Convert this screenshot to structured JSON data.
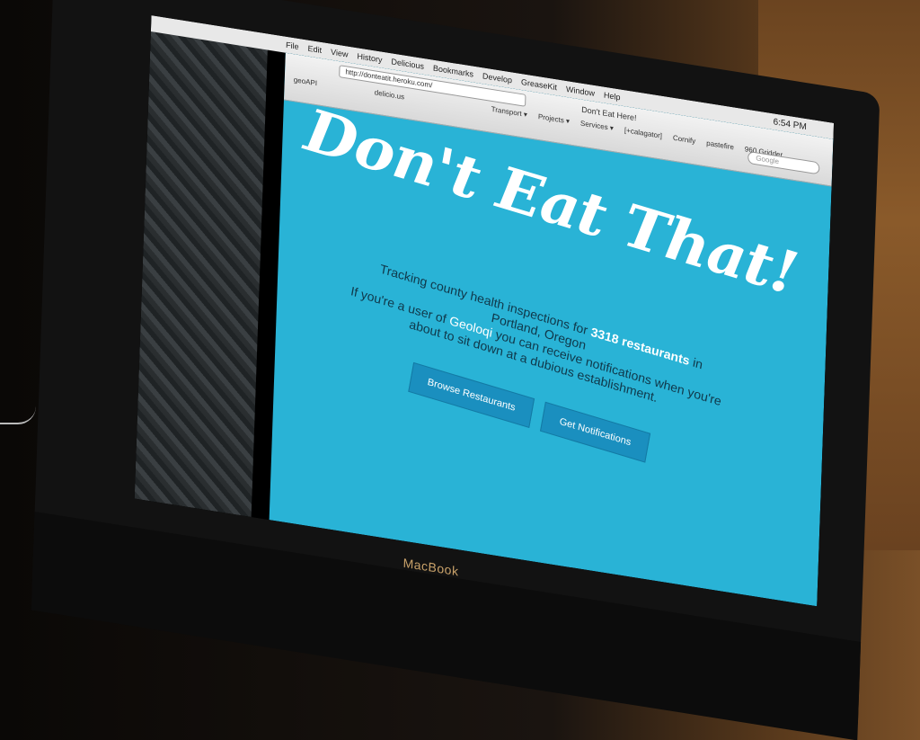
{
  "menubar": {
    "items": [
      "File",
      "Edit",
      "View",
      "History",
      "Delicious",
      "Bookmarks",
      "Develop",
      "GreaseKit",
      "Window",
      "Help"
    ],
    "clock": "6:54 PM"
  },
  "browser": {
    "url": "http://donteatit.heroku.com/",
    "tab_title": "Don't Eat Here!",
    "bookmarks": [
      "Transport ▾",
      "Projects ▾",
      "Services ▾",
      "[+calagator]",
      "Cornify",
      "pastefire",
      "960 Gridder"
    ],
    "search_placeholder": "Google",
    "shortcut1": "geoAPI",
    "shortcut2": "delicio.us"
  },
  "page": {
    "headline": "Don't Eat That!",
    "tagline_pre": "Tracking county health inspections for ",
    "tagline_count": "3318 restaurants",
    "tagline_post": " in Portland, Oregon",
    "notify_pre": "If you're a user of ",
    "notify_link": "Geoloqi",
    "notify_post": " you can receive notifications when you're about to sit down at a dubious establishment.",
    "browse_button": "Browse Restaurants",
    "notify_button": "Get Notifications"
  },
  "device": {
    "brand": "MacBook"
  }
}
